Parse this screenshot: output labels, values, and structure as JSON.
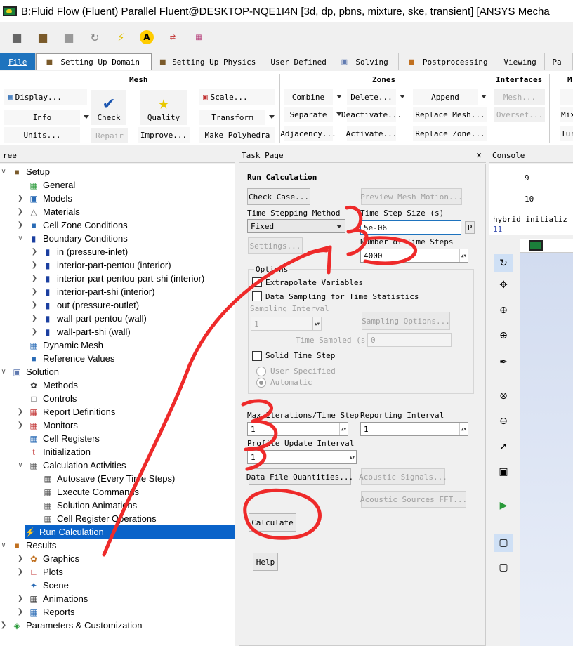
{
  "window": {
    "title": "B:Fluid Flow (Fluent) Parallel Fluent@DESKTOP-NQE1I4N  [3d, dp, pbns, mixture, ske, transient] [ANSYS Mecha"
  },
  "ribbon_tabs": [
    {
      "label": "File"
    },
    {
      "label": "Setting Up Domain"
    },
    {
      "label": "Setting Up Physics"
    },
    {
      "label": "User Defined"
    },
    {
      "label": "Solving"
    },
    {
      "label": "Postprocessing"
    },
    {
      "label": "Viewing"
    },
    {
      "label": "Pa"
    }
  ],
  "ribbon": {
    "mesh": {
      "title": "Mesh",
      "display": "Display...",
      "info": "Info",
      "units": "Units...",
      "check": "Check",
      "repair": "Repair",
      "quality": "Quality",
      "improve": "Improve...",
      "scale": "Scale...",
      "transform": "Transform",
      "make_polyhedra": "Make Polyhedra"
    },
    "zones": {
      "title": "Zones",
      "combine": "Combine",
      "separate": "Separate",
      "adjacency": "Adjacency...",
      "delete": "Delete...",
      "deactivate": "Deactivate...",
      "activate": "Activate...",
      "append": "Append",
      "replace_mesh": "Replace Mesh...",
      "replace_zone": "Replace Zone..."
    },
    "interfaces": {
      "title": "Interfaces",
      "mesh": "Mesh...",
      "overset": "Overset..."
    },
    "cut": {
      "title": "M",
      "b1": "",
      "b2": "Mix",
      "b3": "Tur"
    }
  },
  "panels": {
    "tree_title": "ree",
    "task_title": "Task Page",
    "console_title": "Console"
  },
  "tree": [
    {
      "label": "Setup",
      "level": 0,
      "chev": "v"
    },
    {
      "label": "General",
      "level": 1,
      "chev": ""
    },
    {
      "label": "Models",
      "level": 1,
      "chev": ">"
    },
    {
      "label": "Materials",
      "level": 1,
      "chev": ">"
    },
    {
      "label": "Cell Zone Conditions",
      "level": 1,
      "chev": ">"
    },
    {
      "label": "Boundary Conditions",
      "level": 1,
      "chev": "v"
    },
    {
      "label": "in (pressure-inlet)",
      "level": 2,
      "chev": ">"
    },
    {
      "label": "interior-part-pentou (interior)",
      "level": 2,
      "chev": ">"
    },
    {
      "label": "interior-part-pentou-part-shi (interior)",
      "level": 2,
      "chev": ">"
    },
    {
      "label": "interior-part-shi (interior)",
      "level": 2,
      "chev": ">"
    },
    {
      "label": "out (pressure-outlet)",
      "level": 2,
      "chev": ">"
    },
    {
      "label": "wall-part-pentou (wall)",
      "level": 2,
      "chev": ">"
    },
    {
      "label": "wall-part-shi (wall)",
      "level": 2,
      "chev": ">"
    },
    {
      "label": "Dynamic Mesh",
      "level": 1,
      "chev": ""
    },
    {
      "label": "Reference Values",
      "level": 1,
      "chev": ""
    },
    {
      "label": "Solution",
      "level": 0,
      "chev": "v"
    },
    {
      "label": "Methods",
      "level": 1,
      "chev": ""
    },
    {
      "label": "Controls",
      "level": 1,
      "chev": ""
    },
    {
      "label": "Report Definitions",
      "level": 1,
      "chev": ">"
    },
    {
      "label": "Monitors",
      "level": 1,
      "chev": ">"
    },
    {
      "label": "Cell Registers",
      "level": 1,
      "chev": ""
    },
    {
      "label": "Initialization",
      "level": 1,
      "chev": ""
    },
    {
      "label": "Calculation Activities",
      "level": 1,
      "chev": "v"
    },
    {
      "label": "Autosave (Every Time Steps)",
      "level": 2,
      "chev": ""
    },
    {
      "label": "Execute Commands",
      "level": 2,
      "chev": ""
    },
    {
      "label": "Solution Animations",
      "level": 2,
      "chev": ""
    },
    {
      "label": "Cell Register Operations",
      "level": 2,
      "chev": ""
    },
    {
      "label": "Run Calculation",
      "level": 1,
      "chev": "",
      "selected": true
    },
    {
      "label": "Results",
      "level": 0,
      "chev": "v"
    },
    {
      "label": "Graphics",
      "level": 1,
      "chev": ">"
    },
    {
      "label": "Plots",
      "level": 1,
      "chev": ">"
    },
    {
      "label": "Scene",
      "level": 1,
      "chev": ""
    },
    {
      "label": "Animations",
      "level": 1,
      "chev": ">"
    },
    {
      "label": "Reports",
      "level": 1,
      "chev": ">"
    },
    {
      "label": "Parameters & Customization",
      "level": 0,
      "chev": ">"
    }
  ],
  "task": {
    "heading": "Run Calculation",
    "check_case": "Check Case...",
    "preview_mesh_motion": "Preview Mesh Motion...",
    "time_stepping_method_label": "Time Stepping Method",
    "time_stepping_method_value": "Fixed",
    "settings": "Settings...",
    "time_step_size_label": "Time Step Size (s)",
    "time_step_size_value": "5e-06",
    "p_button": "P",
    "num_time_steps_label": "Number of Time Steps",
    "num_time_steps_value": "4000",
    "options_label": "Options",
    "extrapolate_variables": "Extrapolate Variables",
    "data_sampling": "Data Sampling for Time Statistics",
    "sampling_interval_label": "Sampling Interval",
    "sampling_interval_value": "1",
    "sampling_options": "Sampling Options...",
    "time_sampled_label": "Time Sampled (s)",
    "time_sampled_value": "0",
    "solid_time_step": "Solid Time Step",
    "user_specified": "User Specified",
    "automatic": "Automatic",
    "max_iter_label": "Max Iterations/Time Step",
    "max_iter_value": "1",
    "reporting_interval_label": "Reporting Interval",
    "reporting_interval_value": "1",
    "profile_update_label": "Profile Update Interval",
    "profile_update_value": "1",
    "data_file_quantities": "Data File Quantities...",
    "acoustic_signals": "Acoustic Signals...",
    "acoustic_sources_fft": "Acoustic Sources FFT...",
    "calculate": "Calculate",
    "help": "Help"
  },
  "console": {
    "line1": "9",
    "line2": "10",
    "line3": "hybrid initializ",
    "line4": "11"
  },
  "colors": {
    "selection": "#0a63c9",
    "file_tab": "#1e73be",
    "annotation": "#ee2a2a"
  }
}
